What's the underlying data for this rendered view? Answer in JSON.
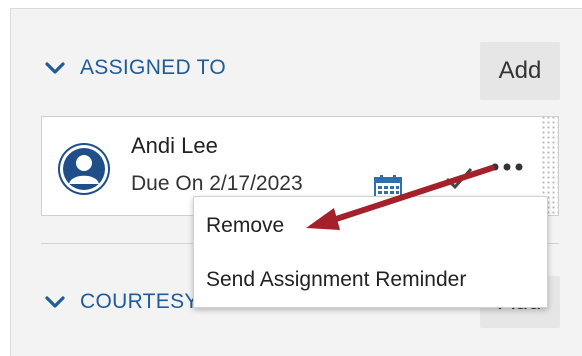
{
  "assigned_section": {
    "title": "ASSIGNED TO",
    "add_label": "Add"
  },
  "assignee": {
    "name": "Andi Lee",
    "due": "Due On 2/17/2023"
  },
  "context_menu": {
    "items": [
      {
        "label": "Remove"
      },
      {
        "label": "Send Assignment Reminder"
      }
    ]
  },
  "courtesy_section": {
    "title": "COURTESY COPIES",
    "add_label": "Add"
  },
  "colors": {
    "accent_blue": "#1f5c99",
    "avatar_blue": "#1f4e89",
    "arrow_red": "#a4202a"
  },
  "icons": [
    "chevron-down-icon",
    "user-avatar-icon",
    "calendar-icon",
    "checkmark-icon",
    "more-options-icon",
    "drag-handle-icon"
  ]
}
